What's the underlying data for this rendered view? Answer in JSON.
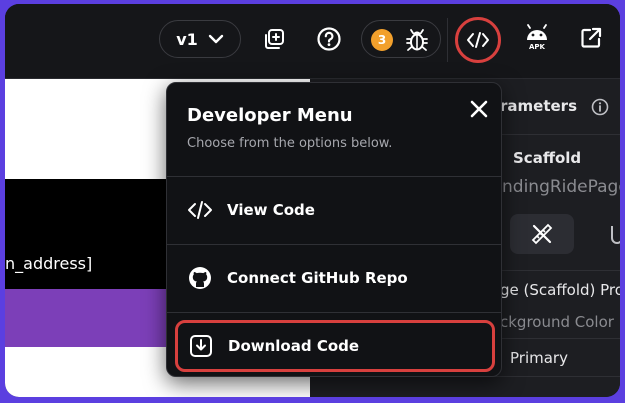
{
  "toolbar": {
    "version_label": "v1",
    "issue_count": "3",
    "apk_label": "APK",
    "icons": [
      "add-page-icon",
      "help-icon",
      "bug-icon",
      "code-icon",
      "android-icon",
      "open-external-icon"
    ],
    "accent_highlight": "#d8403e"
  },
  "canvas": {
    "address_text": "n_address]",
    "accent_purple": "#7c3fb8"
  },
  "panel": {
    "header_text": "rameters",
    "widget_type": "Scaffold",
    "widget_name": "ndingRidePage",
    "section_label": "ge (Scaffold) Pro",
    "background_label": "ckground Color",
    "background_value": "Primary"
  },
  "dev_menu": {
    "title": "Developer Menu",
    "subtitle": "Choose from the options below.",
    "items": [
      {
        "label": "View Code",
        "icon": "code-icon"
      },
      {
        "label": "Connect GitHub Repo",
        "icon": "github-icon"
      },
      {
        "label": "Download Code",
        "icon": "download-icon"
      }
    ]
  }
}
